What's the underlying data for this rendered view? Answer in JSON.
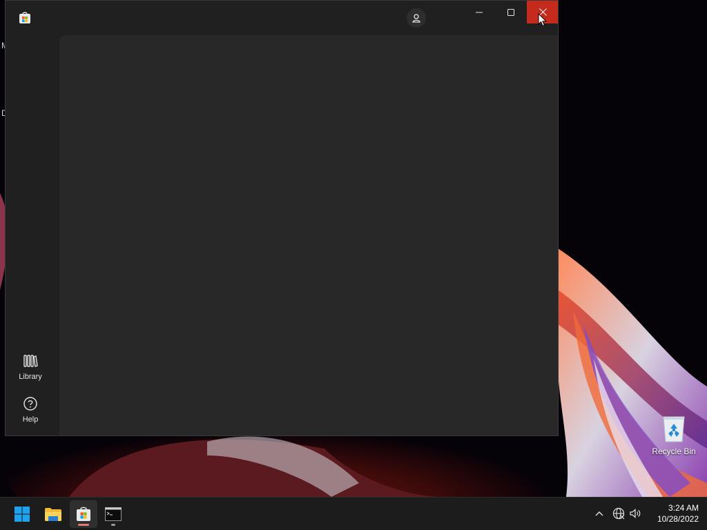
{
  "desktop": {
    "edge_labels": [
      "M",
      "D"
    ],
    "recycle_bin_label": "Recycle Bin"
  },
  "store_window": {
    "title_bar": {
      "app_icon": "microsoft-store-icon",
      "account_icon": "person-icon",
      "minimize_icon": "minimize-icon",
      "maximize_icon": "maximize-icon",
      "close_icon": "close-icon",
      "close_hover_color": "#c42b1c"
    },
    "nav_rail": {
      "items": [
        {
          "label": "Library",
          "icon": "library-icon"
        },
        {
          "label": "Help",
          "icon": "help-icon"
        }
      ]
    }
  },
  "taskbar": {
    "apps": [
      {
        "name": "Start",
        "icon": "windows-start-icon"
      },
      {
        "name": "File Explorer",
        "icon": "folder-icon"
      },
      {
        "name": "Microsoft Store",
        "icon": "microsoft-store-icon",
        "active": true
      },
      {
        "name": "Terminal",
        "icon": "terminal-icon"
      }
    ],
    "tray": {
      "icons": [
        "chevron-up-icon",
        "network-icon",
        "volume-icon"
      ],
      "time": "3:24 AM",
      "date": "10/28/2022"
    }
  },
  "colors": {
    "window_bg": "#202020",
    "content_bg": "#282828",
    "taskbar_bg": "#1c1c1c",
    "accent_store": "#e77a73"
  }
}
